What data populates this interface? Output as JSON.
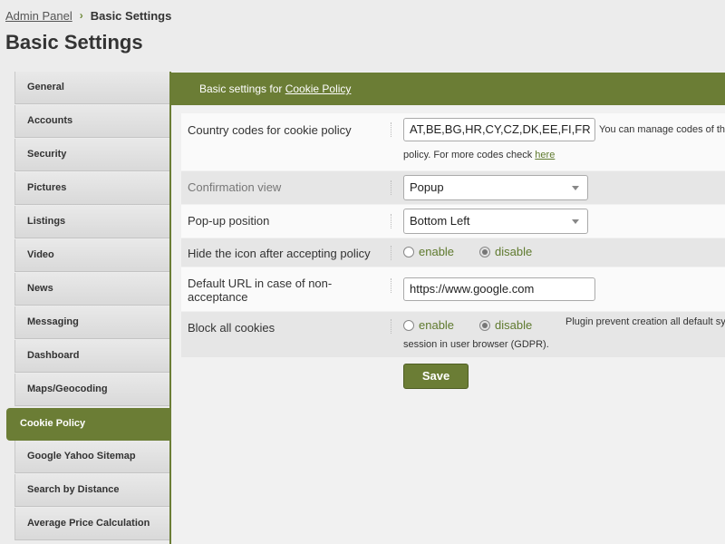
{
  "breadcrumb": {
    "root": "Admin Panel",
    "separator": "›",
    "current": "Basic Settings"
  },
  "page_title": "Basic Settings",
  "sidebar": {
    "items": [
      {
        "label": "General"
      },
      {
        "label": "Accounts"
      },
      {
        "label": "Security"
      },
      {
        "label": "Pictures"
      },
      {
        "label": "Listings"
      },
      {
        "label": "Video"
      },
      {
        "label": "News"
      },
      {
        "label": "Messaging"
      },
      {
        "label": "Dashboard"
      },
      {
        "label": "Maps/Geocoding"
      },
      {
        "label": "Cookie Policy",
        "active": true
      },
      {
        "label": "Google Yahoo Sitemap"
      },
      {
        "label": "Search by Distance"
      },
      {
        "label": "Average Price Calculation"
      }
    ]
  },
  "panel": {
    "header_prefix": "Basic settings for ",
    "header_link": "Cookie Policy"
  },
  "form": {
    "country_codes": {
      "label": "Country codes for cookie policy",
      "value": "AT,BE,BG,HR,CY,CZ,DK,EE,FI,FR",
      "help_line1": "You can manage codes of th",
      "help_line2_prefix": "policy. For more codes check ",
      "help_link": "here"
    },
    "confirmation_view": {
      "label": "Confirmation view",
      "value": "Popup"
    },
    "popup_position": {
      "label": "Pop-up position",
      "value": "Bottom Left"
    },
    "hide_icon": {
      "label": "Hide the icon after accepting policy",
      "enable_label": "enable",
      "disable_label": "disable",
      "selected": "disable"
    },
    "default_url": {
      "label": "Default URL in case of non-acceptance",
      "value": "https://www.google.com"
    },
    "block_cookies": {
      "label": "Block all cookies",
      "enable_label": "enable",
      "disable_label": "disable",
      "selected": "disable",
      "help_line1": "Plugin prevent creation all default sy",
      "help_line2": "session in user browser (GDPR)."
    },
    "save_label": "Save"
  },
  "colors": {
    "accent": "#6b7d35",
    "link_green": "#5f7a2e",
    "background": "#ececec"
  }
}
